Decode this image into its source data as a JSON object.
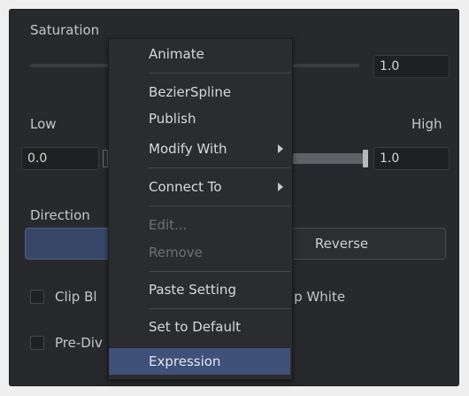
{
  "panel": {
    "saturation": {
      "label": "Saturation",
      "value": "1.0"
    },
    "range": {
      "low_label": "Low",
      "high_label": "High",
      "low_value": "0.0",
      "high_value": "1.0"
    },
    "direction": {
      "label": "Direction",
      "forward_label": "F",
      "reverse_label": "Reverse"
    },
    "clip_black_label": "Clip Bl",
    "clip_white_label": "ip White",
    "pre_divide_label": "Pre-Div"
  },
  "context_menu": {
    "items": [
      {
        "label": "Animate"
      },
      {
        "label": "BezierSpline"
      },
      {
        "label": "Publish"
      },
      {
        "label": "Modify With"
      },
      {
        "label": "Connect To"
      },
      {
        "label": "Edit..."
      },
      {
        "label": "Remove"
      },
      {
        "label": "Paste Setting"
      },
      {
        "label": "Set to Default"
      },
      {
        "label": "Expression"
      }
    ]
  },
  "colors": {
    "panel_bg": "#28292c",
    "accent": "#3f5079",
    "text": "#c6c6c6",
    "disabled_text": "#6e6f74"
  }
}
